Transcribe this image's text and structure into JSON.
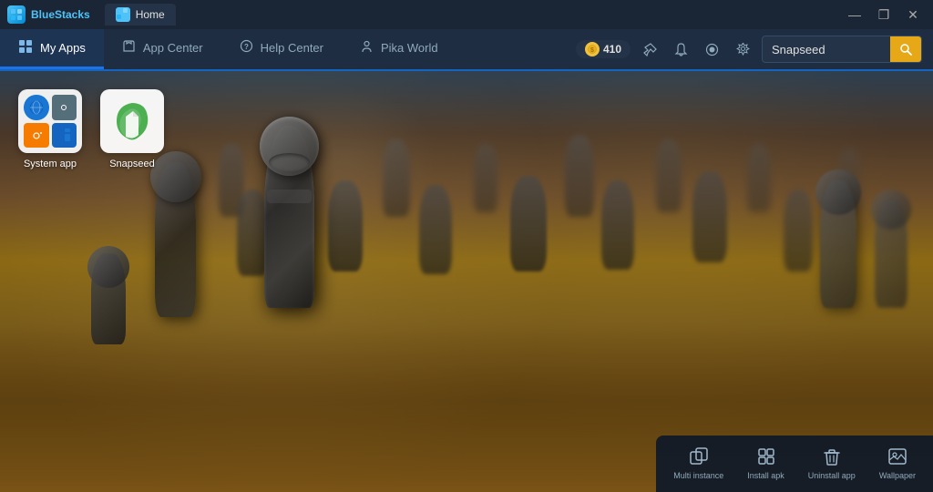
{
  "titleBar": {
    "appName": "BlueStacks",
    "tabTitle": "Home",
    "controls": {
      "minimize": "—",
      "maximize": "❐",
      "close": "✕"
    }
  },
  "nav": {
    "tabs": [
      {
        "id": "my-apps",
        "label": "My Apps",
        "icon": "⊞",
        "active": true
      },
      {
        "id": "app-center",
        "label": "App Center",
        "icon": "🛍"
      },
      {
        "id": "help-center",
        "label": "Help Center",
        "icon": "?"
      },
      {
        "id": "pika-world",
        "label": "Pika World",
        "icon": "👤"
      }
    ],
    "search": {
      "placeholder": "Snapseed",
      "value": "Snapseed"
    },
    "coins": "410"
  },
  "apps": [
    {
      "id": "system-app",
      "label": "System app",
      "type": "system"
    },
    {
      "id": "snapseed",
      "label": "Snapseed",
      "type": "snapseed"
    }
  ],
  "bottomToolbar": {
    "buttons": [
      {
        "id": "multi-instance",
        "label": "Multi instance",
        "icon": "⧉"
      },
      {
        "id": "install-apk",
        "label": "Install apk",
        "icon": "⊞"
      },
      {
        "id": "uninstall-app",
        "label": "Uninstall app",
        "icon": "🗑"
      },
      {
        "id": "wallpaper",
        "label": "Wallpaper",
        "icon": "🖼"
      }
    ]
  }
}
